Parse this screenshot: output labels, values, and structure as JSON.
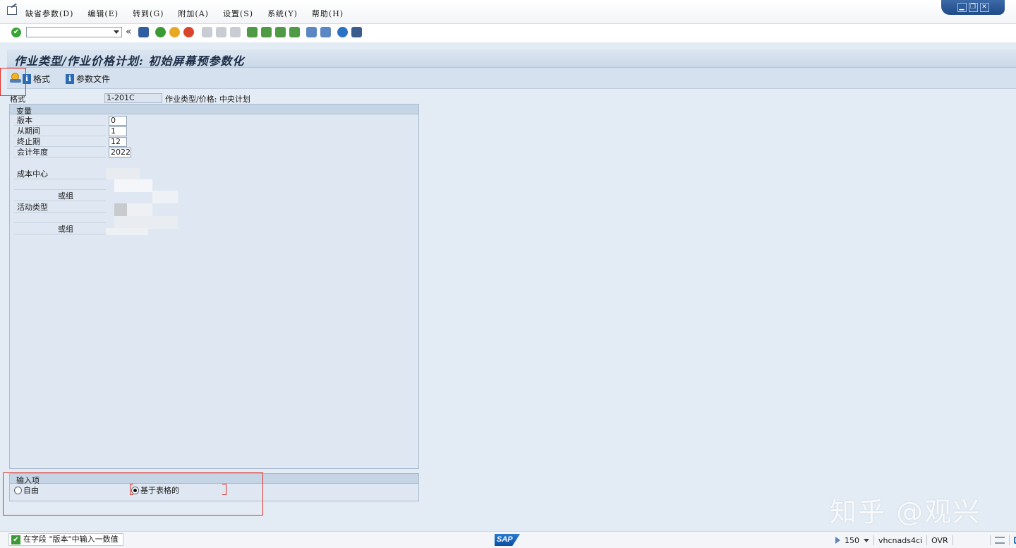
{
  "menu": {
    "items": [
      "缺省参数(D)",
      "编辑(E)",
      "转到(G)",
      "附加(A)",
      "设置(S)",
      "系统(Y)",
      "帮助(H)"
    ]
  },
  "window": {
    "minimize": "▁",
    "restore": "❐",
    "close": "✕"
  },
  "toolbar": {
    "command_value": "",
    "more": "«"
  },
  "title": "作业类型/作业价格计划: 初始屏幕预参数化",
  "apptoolbar": {
    "format_label": "格式",
    "profile_label": "参数文件"
  },
  "header": {
    "format_label": "格式",
    "format_value": "1-201C",
    "format_desc": "作业类型/价格: 中央计划"
  },
  "variables": {
    "title": "变量",
    "version_label": "版本",
    "version_value": "0",
    "from_period_label": "从期间",
    "from_period_value": "1",
    "to_period_label": "终止期",
    "to_period_value": "12",
    "fiscal_year_label": "会计年度",
    "fiscal_year_value": "2022",
    "cost_center_label": "成本中心",
    "or_group_label": "或组",
    "activity_type_label": "活动类型",
    "or_group2_label": "或组"
  },
  "input_options": {
    "title": "输入项",
    "free_label": "自由",
    "form_label": "基于表格的",
    "selected": "form"
  },
  "status": {
    "message": "在字段 \"版本\"中输入一数值",
    "sap_logo": "SAP",
    "session": "150",
    "server": "vhcnads4ci",
    "mode": "OVR"
  },
  "watermark": "知乎 @观兴",
  "colors": {
    "accent": "#2c6bb3",
    "highlight_box": "#e0302a",
    "ok_green": "#3aa335"
  }
}
